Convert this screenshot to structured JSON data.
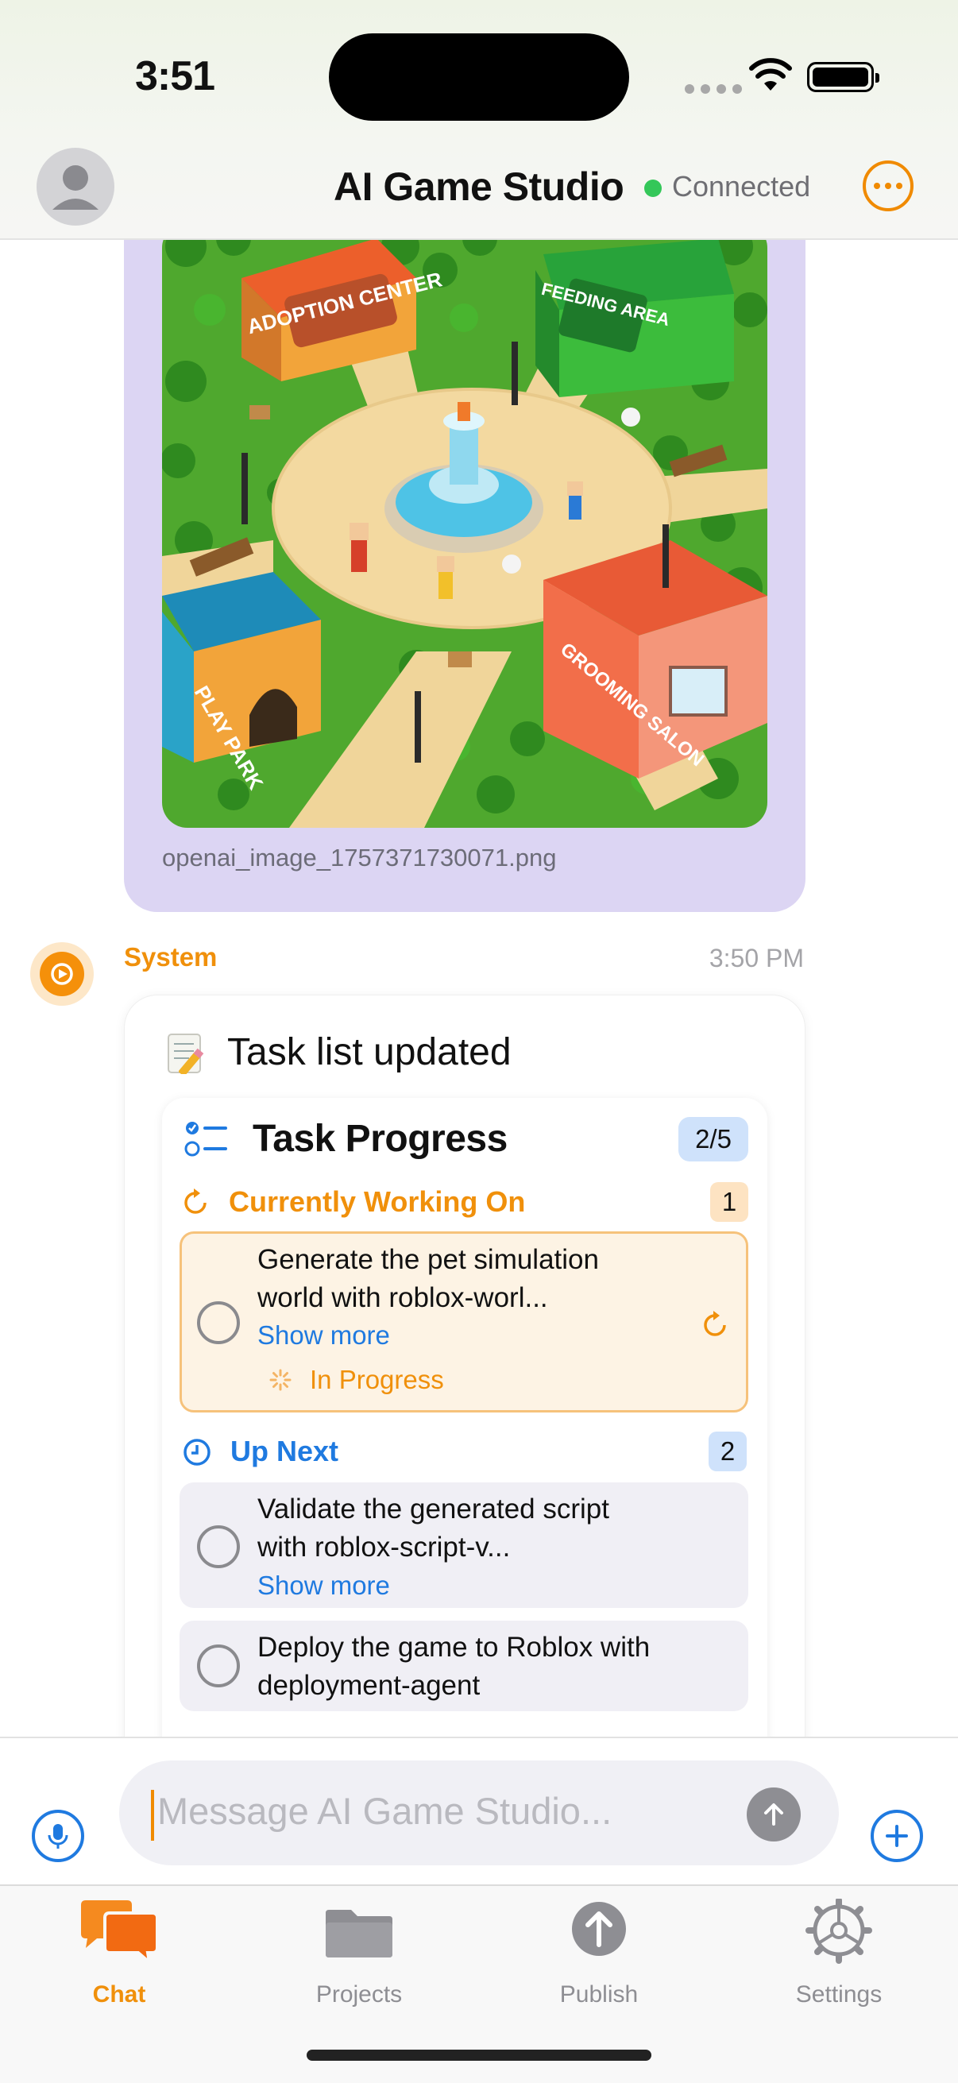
{
  "status_bar": {
    "time": "3:51"
  },
  "header": {
    "title": "AI Game Studio",
    "connection_status": "Connected",
    "accent_color": "#f08a00"
  },
  "image_message": {
    "file_name": "openai_image_1757371730071.png",
    "signs": [
      "ADOPTION CENTER",
      "FEEDING AREA",
      "PLAY PARK",
      "GROOMING SALON"
    ]
  },
  "system_message": {
    "sender": "System",
    "time": "3:50 PM",
    "heading": "Task list updated"
  },
  "task_progress": {
    "title": "Task Progress",
    "count": "2/5",
    "sections": {
      "current": {
        "label": "Currently Working On",
        "count": "1",
        "task": {
          "line1": "Generate the pet simulation",
          "line2": "world with roblox-worl...",
          "show_more": "Show more",
          "status": "In Progress"
        }
      },
      "next": {
        "label": "Up Next",
        "count": "2",
        "tasks": [
          {
            "line1": "Validate the generated script",
            "line2": "with roblox-script-v...",
            "show_more": "Show more"
          },
          {
            "line1": "Deploy the game to Roblox with",
            "line2": "deployment-agent"
          }
        ]
      }
    }
  },
  "composer": {
    "placeholder": "Message AI Game Studio..."
  },
  "tabs": [
    {
      "label": "Chat",
      "icon": "chat-bubbles-icon",
      "active": true
    },
    {
      "label": "Projects",
      "icon": "folder-icon",
      "active": false
    },
    {
      "label": "Publish",
      "icon": "upload-icon",
      "active": false
    },
    {
      "label": "Settings",
      "icon": "gear-icon",
      "active": false
    }
  ]
}
